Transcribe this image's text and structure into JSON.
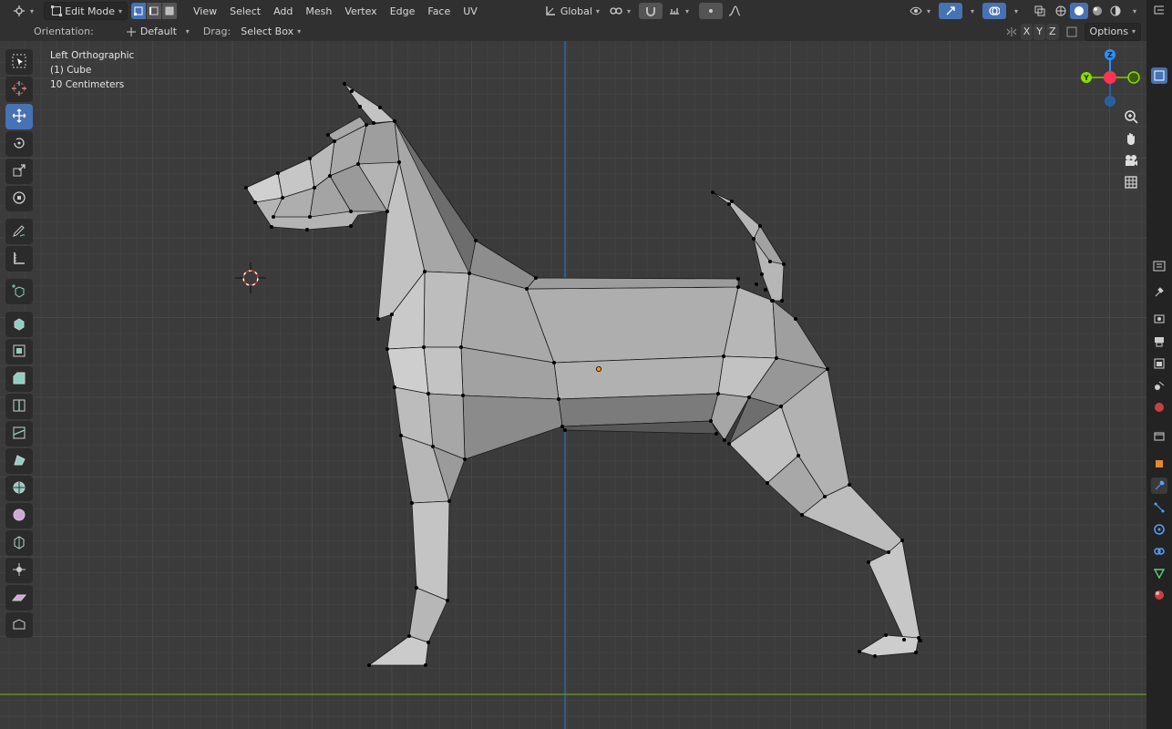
{
  "header": {
    "mode": "Edit Mode",
    "menus": [
      "View",
      "Select",
      "Add",
      "Mesh",
      "Vertex",
      "Edge",
      "Face",
      "UV"
    ],
    "transform_orientation": "Global"
  },
  "tool_settings": {
    "orientation_label": "Orientation:",
    "orientation_value": "Default",
    "drag_label": "Drag:",
    "drag_value": "Select Box",
    "axes": [
      "X",
      "Y",
      "Z"
    ],
    "options_label": "Options"
  },
  "viewport_info": {
    "view_name": "Left Orthographic",
    "object": "(1) Cube",
    "scale": "10 Centimeters"
  },
  "gizmo": {
    "axis_z": "Z",
    "axis_y": "Y"
  },
  "colors": {
    "accent": "#4772b3",
    "x_axis": "#ff3352",
    "y_axis": "#8bdc00",
    "z_axis": "#2890ff",
    "mesh_face": "#b9b9b9"
  },
  "toolbar_tools": [
    "tweak",
    "cursor",
    "move",
    "rotate",
    "scale",
    "transform",
    "annotate",
    "measure",
    "add-cube",
    "extrude",
    "inset",
    "bevel",
    "loop-cut",
    "knife",
    "poly-build",
    "spin",
    "smooth",
    "edge-slide",
    "shrink-fatten",
    "shear",
    "rip"
  ],
  "right_tabs": [
    "tool",
    "render",
    "output",
    "view-layer",
    "scene",
    "world",
    "collection",
    "object",
    "modifiers",
    "particles",
    "physics",
    "constraints",
    "data",
    "material"
  ]
}
